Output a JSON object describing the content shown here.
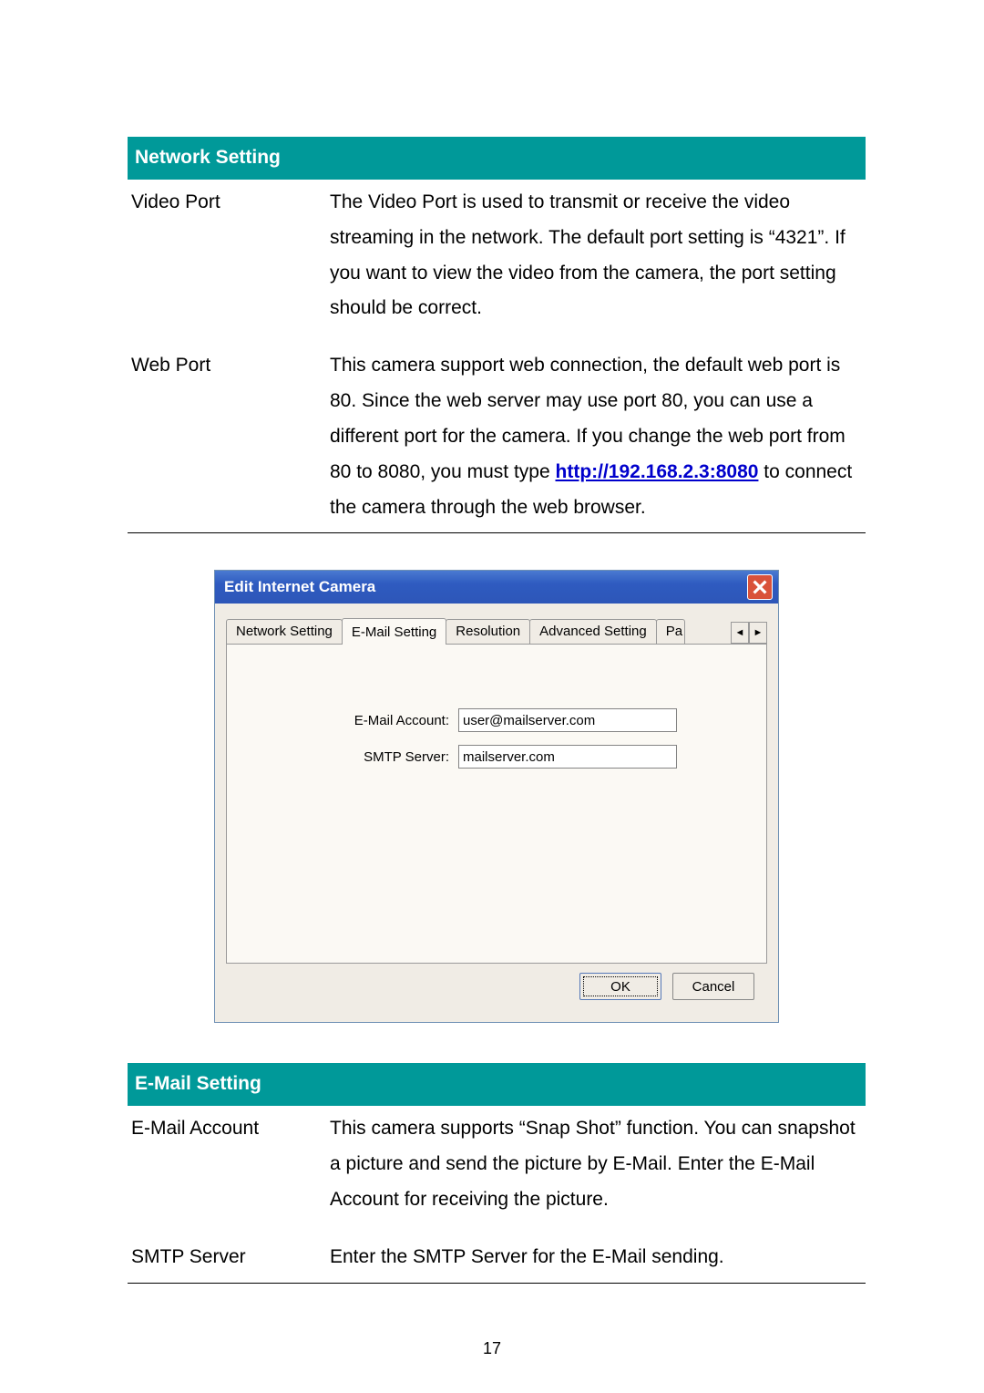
{
  "sections": {
    "network": {
      "header": "Network Setting",
      "rows": {
        "videoPort": {
          "term": "Video Port",
          "desc": "The Video Port is used to transmit or receive the video streaming in the network. The default port setting is “4321”. If you want to view the video from the camera, the port setting should be correct."
        },
        "webPort": {
          "term": "Web Port",
          "desc_pre": "This camera support web connection, the default web port is 80. Since the web server may use port 80, you can use a different port for the camera. If you change the web port from 80 to 8080, you must type ",
          "link_text": "http://192.168.2.3:8080",
          "desc_post": " to connect the camera through the web browser."
        }
      }
    },
    "email": {
      "header": "E-Mail Setting",
      "rows": {
        "account": {
          "term": "E-Mail Account",
          "desc": "This camera supports “Snap Shot” function. You can snapshot a picture and send the picture by E-Mail. Enter the E-Mail Account for receiving the picture."
        },
        "smtp": {
          "term": "SMTP Server",
          "desc": "Enter the SMTP Server for the E-Mail sending."
        }
      }
    }
  },
  "dialog": {
    "title": "Edit Internet Camera",
    "tabs": {
      "t1": "Network Setting",
      "t2": "E-Mail Setting",
      "t3": "Resolution",
      "t4": "Advanced Setting",
      "t5": "Pa"
    },
    "form": {
      "emailLabel": "E-Mail Account:",
      "emailValue": "user@mailserver.com",
      "smtpLabel": "SMTP Server:",
      "smtpValue": "mailserver.com"
    },
    "buttons": {
      "ok": "OK",
      "cancel": "Cancel"
    }
  },
  "pageNumber": "17"
}
